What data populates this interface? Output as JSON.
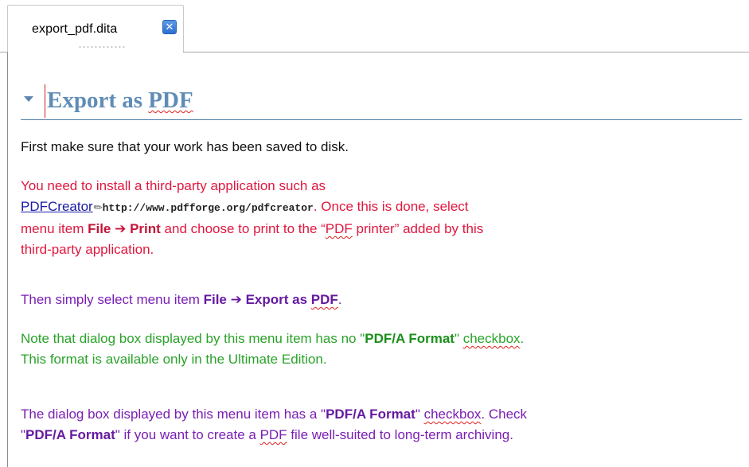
{
  "tab": {
    "title": "export_pdf.dita",
    "close_glyph": "✕"
  },
  "editor": {
    "heading": {
      "prefix": "Export as ",
      "pdf": "PDF"
    },
    "p1": {
      "text": "First make sure that your work has been saved to disk."
    },
    "p2": {
      "line1": "You need to install a third-party application such as",
      "link_text": "PDFCreator",
      "link_icon": "✎",
      "url": "http://www.pdfforge.org/pdfcreator",
      "after_url": ". Once this is done, select",
      "l3_prefix": "menu item ",
      "file": "File",
      "arrow": " ➔ ",
      "print": "Print",
      "l3_mid": " and choose to print to the “",
      "pdf_word": "PDF",
      "l3_end": " printer” added by this",
      "line4": "third-party application."
    },
    "p3": {
      "prefix": "Then simply select menu item ",
      "file": "File",
      "arrow": " ➔ ",
      "export_prefix": "Export as ",
      "pdf": "PDF",
      "suffix": "."
    },
    "p4": {
      "l1_prefix": "Note that dialog box displayed by this menu item has no \"",
      "format": "PDF/A Format",
      "l1_mid": "\" ",
      "checkbox": "checkbox",
      "l1_end": ".",
      "line2": "This format is available only in the Ultimate Edition."
    },
    "p5": {
      "l1_prefix": "The dialog box displayed by this menu item has a \"",
      "format1": "PDF/A Format",
      "l1_mid": "\" ",
      "checkbox": "checkbox",
      "l1_end": ". Check",
      "l2_prefix": "\"",
      "format2": "PDF/A Format",
      "l2_mid": "\" if you want to create a ",
      "pdf": "PDF",
      "l2_end": " file well-suited to long-term archiving."
    }
  },
  "colors": {
    "heading": "#5f8cb6",
    "normal": "#111111",
    "red_paragraph": "#e0173f",
    "purple_paragraph": "#7a1fb4",
    "green_paragraph": "#2aa32a",
    "link": "#1a1aa6",
    "spell_underline": "#e02020",
    "tab_close": "#2d6fd0"
  }
}
